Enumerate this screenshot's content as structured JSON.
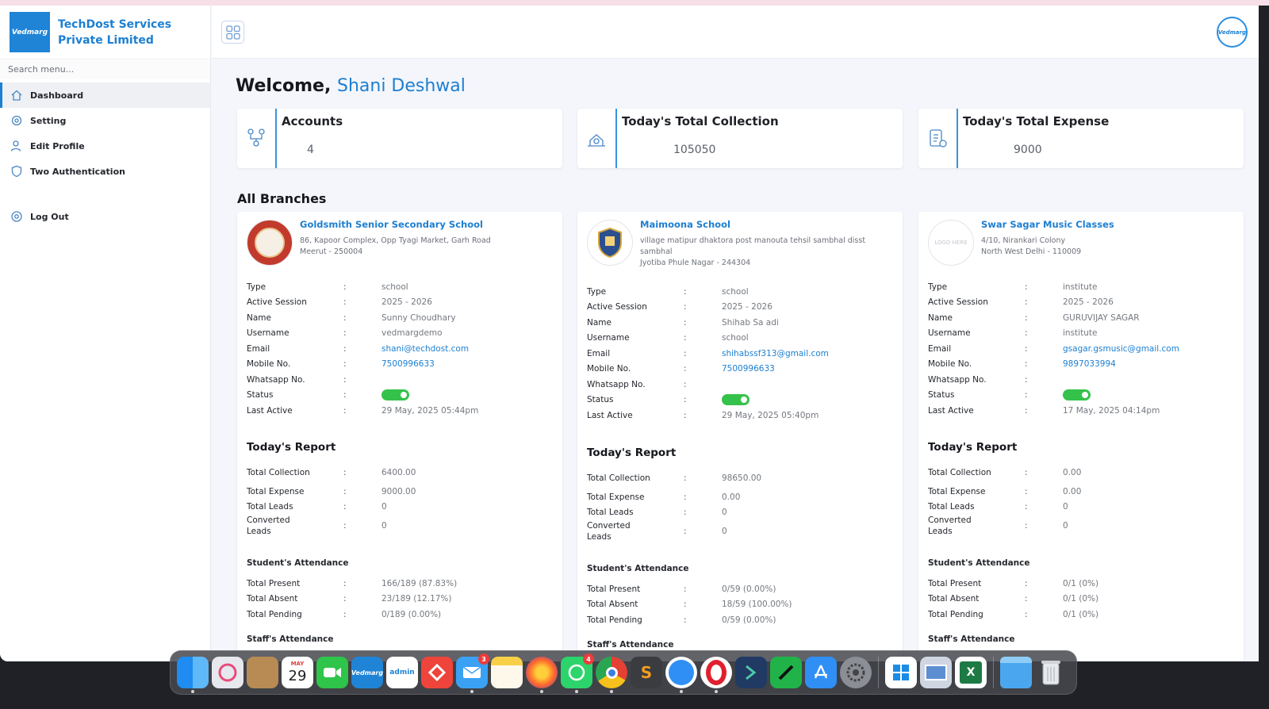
{
  "company": {
    "logo_text": "Vedmarg",
    "name": "TechDost Services Private Limited"
  },
  "sidebar": {
    "search_placeholder": "Search menu...",
    "items": [
      {
        "label": "Dashboard",
        "icon": "home-icon",
        "active": true
      },
      {
        "label": "Setting",
        "icon": "settings-icon"
      },
      {
        "label": "Edit Profile",
        "icon": "user-edit-icon"
      },
      {
        "label": "Two Authentication",
        "icon": "shield-icon"
      }
    ],
    "logout_label": "Log Out"
  },
  "header": {
    "avatar_text": "Vedmarg"
  },
  "welcome": {
    "greeting": "Welcome,",
    "user_name": "Shani Deshwal"
  },
  "stats": [
    {
      "title": "Accounts",
      "value": "4",
      "icon": "accounts-icon"
    },
    {
      "title": "Today's Total Collection",
      "value": "105050",
      "icon": "collection-icon"
    },
    {
      "title": "Today's Total Expense",
      "value": "9000",
      "icon": "expense-icon"
    }
  ],
  "branches_title": "All Branches",
  "labels": {
    "type": "Type",
    "active_session": "Active Session",
    "name": "Name",
    "username": "Username",
    "email": "Email",
    "mobile": "Mobile No.",
    "whatsapp": "Whatsapp No.",
    "status": "Status",
    "last_active": "Last Active",
    "todays_report": "Today's Report",
    "total_collection": "Total Collection",
    "total_expense": "Total Expense",
    "total_leads": "Total Leads",
    "converted_leads": "Converted Leads",
    "students_attendance": "Student's Attendance",
    "total_present": "Total Present",
    "total_absent": "Total Absent",
    "total_pending": "Total Pending",
    "staffs_attendance": "Staff's Attendance",
    "colon": ":"
  },
  "branches": [
    {
      "name": "Goldsmith Senior Secondary School",
      "address_line1": "86, Kapoor Complex, Opp Tyagi Market, Garh Road",
      "address_line2": "Meerut - 250004",
      "address_line3": "",
      "logo_text": "",
      "type": "school",
      "active_session": "2025 - 2026",
      "name_value": "Sunny Choudhary",
      "username": "vedmargdemo",
      "email": "shani@techdost.com",
      "mobile": "7500996633",
      "whatsapp": "",
      "status_on": true,
      "last_active": "29 May, 2025 05:44pm",
      "total_collection": "6400.00",
      "total_expense": "9000.00",
      "total_leads": "0",
      "converted_leads": "0",
      "total_present": "166/189 (87.83%)",
      "total_absent": "23/189 (12.17%)",
      "total_pending": "0/189 (0.00%)"
    },
    {
      "name": "Maimoona School",
      "address_line1": "village matipur dhaktora post manouta tehsil sambhal disst",
      "address_line2": "sambhal",
      "address_line3": "Jyotiba Phule Nagar - 244304",
      "logo_text": "",
      "type": "school",
      "active_session": "2025 - 2026",
      "name_value": "Shihab Sa adi",
      "username": "school",
      "email": "shihabssf313@gmail.com",
      "mobile": "7500996633",
      "whatsapp": "",
      "status_on": true,
      "last_active": "29 May, 2025 05:40pm",
      "total_collection": "98650.00",
      "total_expense": "0.00",
      "total_leads": "0",
      "converted_leads": "0",
      "total_present": "0/59 (0.00%)",
      "total_absent": "18/59 (100.00%)",
      "total_pending": "0/59 (0.00%)"
    },
    {
      "name": "Swar Sagar Music Classes",
      "address_line1": "4/10, Nirankari Colony",
      "address_line2": "North West Delhi - 110009",
      "address_line3": "",
      "logo_text": "LOGO HERE",
      "type": "institute",
      "active_session": "2025 - 2026",
      "name_value": "GURUVIJAY SAGAR",
      "username": "institute",
      "email": "gsagar.gsmusic@gmail.com",
      "mobile": "9897033994",
      "whatsapp": "",
      "status_on": true,
      "last_active": "17 May, 2025 04:14pm",
      "total_collection": "0.00",
      "total_expense": "0.00",
      "total_leads": "0",
      "converted_leads": "0",
      "total_present": "0/1 (0%)",
      "total_absent": "0/1 (0%)",
      "total_pending": "0/1 (0%)"
    }
  ],
  "dock": {
    "calendar_month": "MAY",
    "calendar_day": "29",
    "vedmarg_label": "Vedmarg",
    "vedmarg_admin_label": "admin",
    "mail_badge": "3",
    "whatsapp_badge": "4",
    "apps": [
      "finder-icon",
      "launchpad-icon",
      "contacts-icon",
      "calendar-icon",
      "facetime-icon",
      "vedmarg-app-icon",
      "vedmarg-admin-icon",
      "anydesk-icon",
      "mail-icon",
      "notes-icon",
      "firefox-icon",
      "whatsapp-icon",
      "chrome-icon",
      "sublime-icon",
      "safari-icon",
      "opera-icon",
      "sourcetree-icon",
      "numbers-icon",
      "appstore-icon",
      "system-settings-icon",
      "windows-app-icon",
      "preview-icon",
      "excel-icon",
      "downloads-folder-icon",
      "trash-icon"
    ]
  }
}
